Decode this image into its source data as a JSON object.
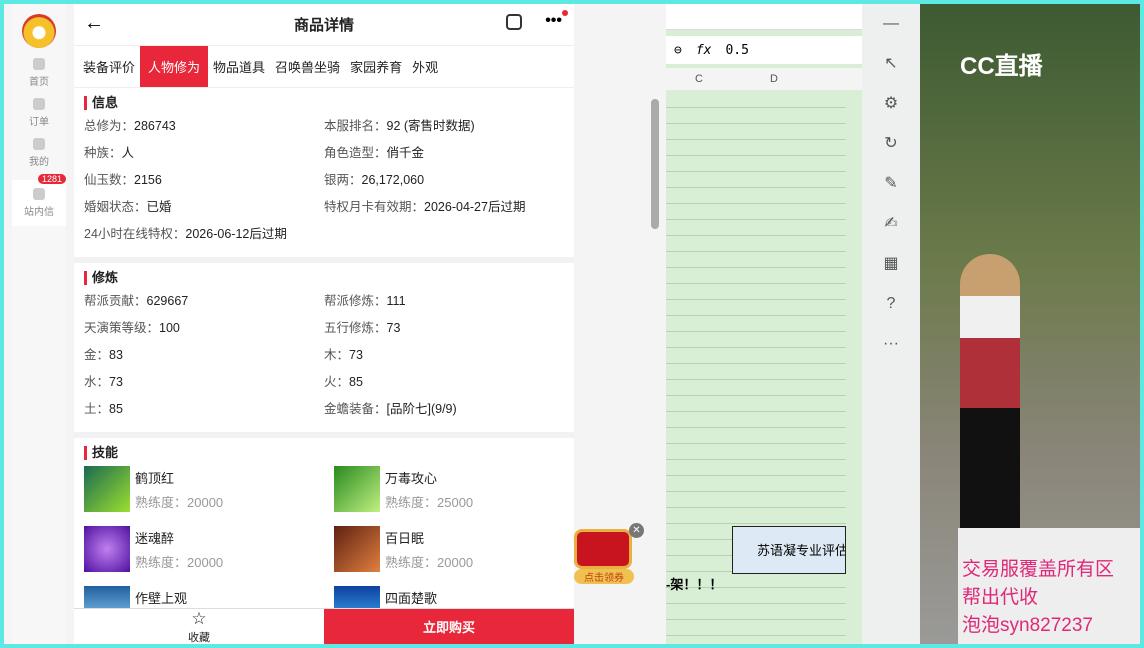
{
  "sidebar": {
    "items": [
      "首页",
      "订单",
      "我的",
      "站内信"
    ],
    "badge": "1281"
  },
  "header": {
    "title": "商品详情"
  },
  "tabs": [
    "装备评价",
    "人物修为",
    "物品道具",
    "召唤兽坐骑",
    "家园养育",
    "外观"
  ],
  "info": {
    "title": "信息",
    "rows": [
      [
        "总修为：",
        "286743"
      ],
      [
        "本服排名：",
        "92 (寄售时数据)"
      ],
      [
        "种族：",
        "人"
      ],
      [
        "角色造型：",
        "俏千金"
      ],
      [
        "仙玉数：",
        "2156"
      ],
      [
        "银两：",
        "26,172,060"
      ],
      [
        "婚姻状态：",
        "已婚"
      ],
      [
        "特权月卡有效期：",
        "2026-04-27后过期"
      ],
      [
        "24小时在线特权：",
        "2026-06-12后过期"
      ]
    ]
  },
  "cultivation": {
    "title": "修炼",
    "rows": [
      [
        "帮派贡献：",
        "629667"
      ],
      [
        "帮派修炼：",
        "111"
      ],
      [
        "天演策等级：",
        "100"
      ],
      [
        "五行修炼：",
        "73"
      ],
      [
        "金：",
        "83"
      ],
      [
        "木：",
        "73"
      ],
      [
        "水：",
        "73"
      ],
      [
        "火：",
        "85"
      ],
      [
        "土：",
        "85"
      ],
      [
        "金蟾装备：",
        "[品阶七](9/9)"
      ]
    ]
  },
  "skills": {
    "title": "技能",
    "items": [
      {
        "name": "鹤顶红",
        "prof": "熟练度：20000"
      },
      {
        "name": "万毒攻心",
        "prof": "熟练度：25000"
      },
      {
        "name": "迷魂醉",
        "prof": "熟练度：20000"
      },
      {
        "name": "百日眠",
        "prof": "熟练度：20000"
      },
      {
        "name": "作壁上观",
        "prof": ""
      },
      {
        "name": "四面楚歌",
        "prof": ""
      }
    ]
  },
  "footer": {
    "fav": "收藏",
    "buy": "立即购买"
  },
  "coupon": "点击领券",
  "sheet": {
    "formula": "0.5",
    "cols": [
      "C",
      "D"
    ],
    "note": "苏语凝专业评估",
    "shelf": "-架！！！"
  },
  "video": {
    "brand": "CC直播",
    "ad": [
      "交易服覆盖所有区",
      "帮出代收",
      "泡泡syn827237"
    ]
  }
}
